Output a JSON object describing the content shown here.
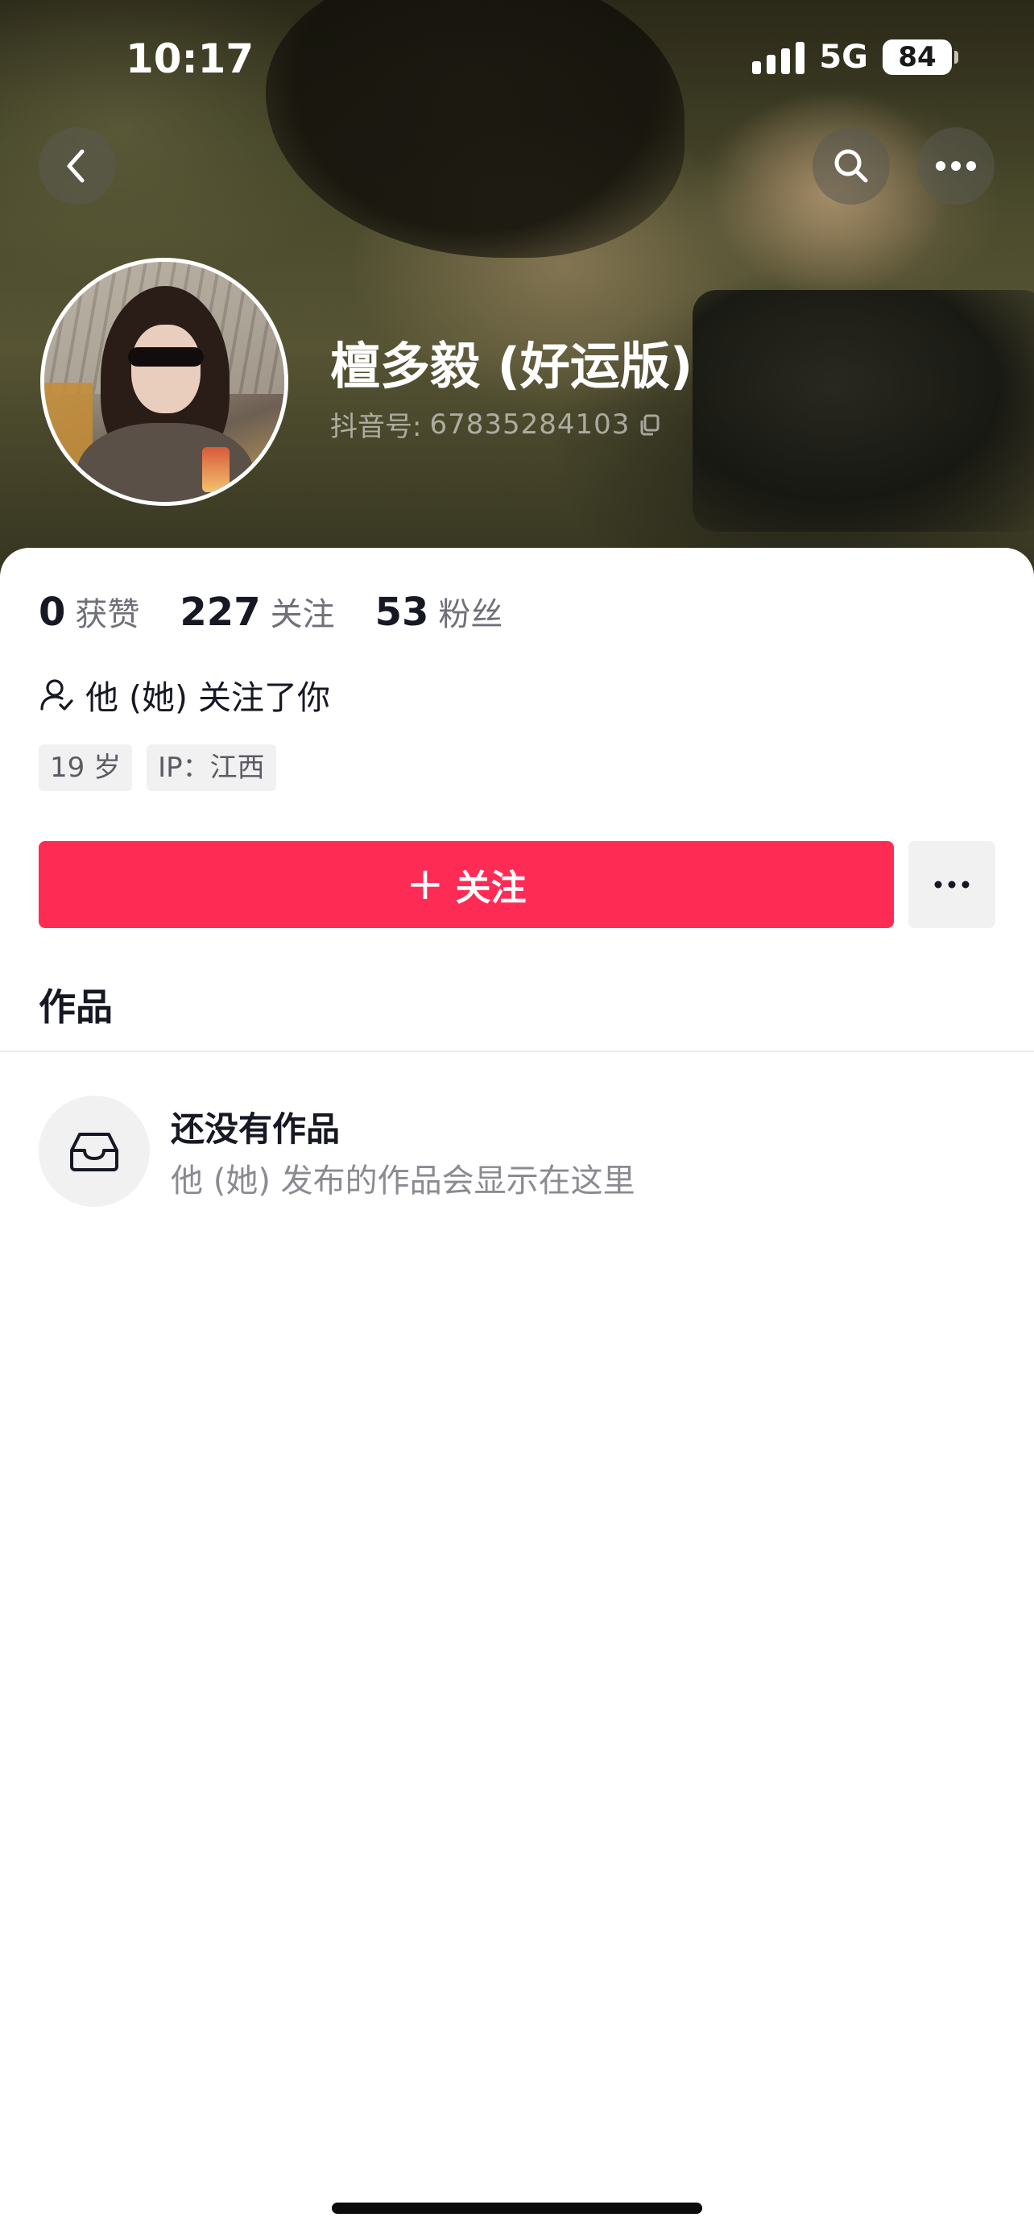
{
  "status_bar": {
    "time": "10:17",
    "network": "5G",
    "battery": "84"
  },
  "header": {
    "back_icon": "chevron-left-icon",
    "search_icon": "search-icon",
    "more_icon": "more-horizontal-icon"
  },
  "profile": {
    "name": "檀多毅 (好运版)",
    "id_label": "抖音号: ",
    "id_value": "67835284103",
    "copy_icon": "copy-icon"
  },
  "stats": [
    {
      "value": "0",
      "label": "获赞"
    },
    {
      "value": "227",
      "label": "关注"
    },
    {
      "value": "53",
      "label": "粉丝"
    }
  ],
  "follows_you": "他 (她) 关注了你",
  "tags": [
    "19 岁",
    "IP：江西"
  ],
  "actions": {
    "follow_plus": "+",
    "follow_label": "关注",
    "more_label": "more"
  },
  "tabs": {
    "works": "作品"
  },
  "empty_state": {
    "title": "还没有作品",
    "description": "他 (她) 发布的作品会显示在这里"
  },
  "colors": {
    "accent": "#fe2c55",
    "text_primary": "#161823",
    "text_secondary": "#8a8b91"
  }
}
